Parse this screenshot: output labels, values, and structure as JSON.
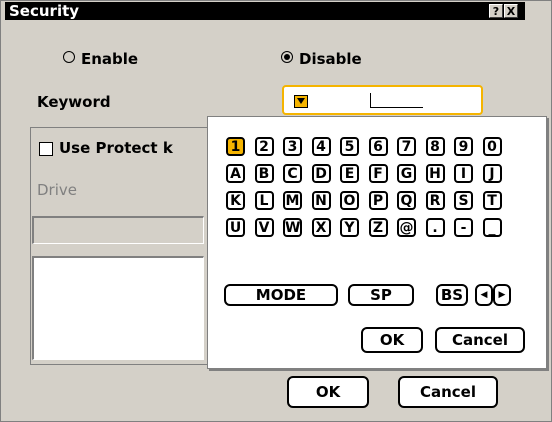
{
  "dialog": {
    "title": "Security",
    "help_button": "?",
    "close_button": "X"
  },
  "radios": {
    "enable": {
      "label": "Enable",
      "selected": false
    },
    "disable": {
      "label": "Disable",
      "selected": true
    }
  },
  "keyword": {
    "label": "Keyword",
    "value": ""
  },
  "protect": {
    "checkbox_label": "Use Protect k",
    "checked": false,
    "drive_label": "Drive"
  },
  "keyboard": {
    "rows": [
      [
        "1",
        "2",
        "3",
        "4",
        "5",
        "6",
        "7",
        "8",
        "9",
        "0"
      ],
      [
        "A",
        "B",
        "C",
        "D",
        "E",
        "F",
        "G",
        "H",
        "I",
        "J"
      ],
      [
        "K",
        "L",
        "M",
        "N",
        "O",
        "P",
        "Q",
        "R",
        "S",
        "T"
      ],
      [
        "U",
        "V",
        "W",
        "X",
        "Y",
        "Z",
        "@",
        ".",
        "-",
        "_"
      ]
    ],
    "selected_key": "1",
    "mode": "MODE",
    "space": "SP",
    "backspace": "BS",
    "left": "◀",
    "right": "▶",
    "ok": "OK",
    "cancel": "Cancel"
  },
  "footer": {
    "ok": "OK",
    "cancel": "Cancel"
  },
  "colors": {
    "highlight": "#f5b400",
    "panel": "#d4d0c8"
  }
}
